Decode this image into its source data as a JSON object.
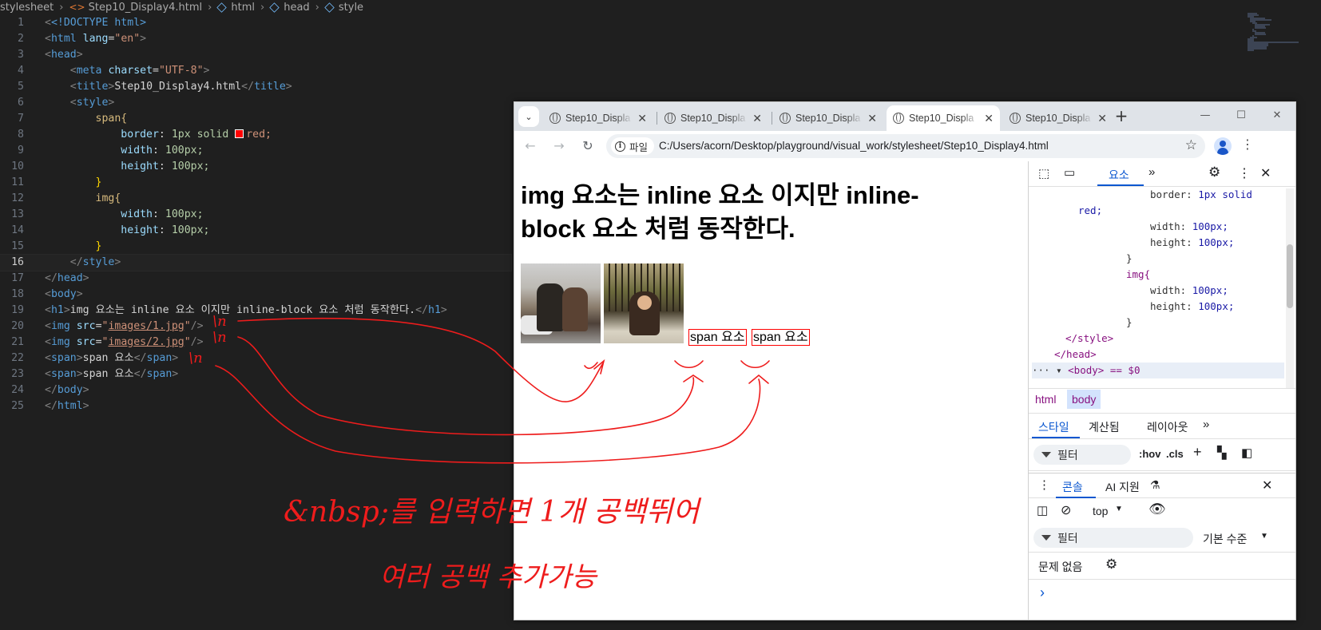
{
  "editor": {
    "breadcrumb": [
      "stylesheet",
      "Step10_Display4.html",
      "html",
      "head",
      "style"
    ],
    "active_line": 16,
    "lines": [
      {
        "n": "1"
      },
      {
        "n": "2"
      },
      {
        "n": "3"
      },
      {
        "n": "4"
      },
      {
        "n": "5"
      },
      {
        "n": "6"
      },
      {
        "n": "7"
      },
      {
        "n": "8"
      },
      {
        "n": "9"
      },
      {
        "n": "10"
      },
      {
        "n": "11"
      },
      {
        "n": "12"
      },
      {
        "n": "13"
      },
      {
        "n": "14"
      },
      {
        "n": "15"
      },
      {
        "n": "16"
      },
      {
        "n": "17"
      },
      {
        "n": "18"
      },
      {
        "n": "19"
      },
      {
        "n": "20"
      },
      {
        "n": "21"
      },
      {
        "n": "22"
      },
      {
        "n": "23"
      },
      {
        "n": "24"
      },
      {
        "n": "25"
      }
    ],
    "code": {
      "doctype": "<!DOCTYPE html>",
      "lang_attr": "lang",
      "lang_val": "\"en\"",
      "charset_val": "\"UTF-8\"",
      "title_text": "Step10_Display4.html",
      "span_sel": "span{",
      "border_prop": "border",
      "border_val_1": "1px solid",
      "border_val_2": "red;",
      "width_prop": "width",
      "width_val": "100px;",
      "height_prop": "height",
      "height_val": "100px;",
      "img_sel": "img{",
      "h1_text": "img 요소는 inline 요소 이지만 inline-block 요소 처럼 동작한다.",
      "img1_src": "images/1.jpg",
      "img2_src": "images/2.jpg",
      "span_text": "span 요소"
    }
  },
  "browser": {
    "tabs": [
      {
        "title": "Step10_Displa"
      },
      {
        "title": "Step10_Displa"
      },
      {
        "title": "Step10_Displa"
      },
      {
        "title": "Step10_Displa"
      },
      {
        "title": "Step10_Displa"
      }
    ],
    "active_tab": 3,
    "site_info_label": "파일",
    "url": "C:/Users/acorn/Desktop/playground/visual_work/stylesheet/Step10_Display4.html",
    "page": {
      "h1_line1": "img 요소는 inline 요소 이지만 inline-",
      "h1_line2": "block 요소 처럼 동작한다.",
      "span1": "span 요소",
      "span2": "span 요소"
    }
  },
  "devtools": {
    "main_tab": "요소",
    "dom_lines": {
      "l1_prop": "border:",
      "l1_val": "1px solid",
      "l2_val": "red;",
      "width": "width:",
      "height": "height:",
      "num": "100px;",
      "brace": "}",
      "img_sel": "img{",
      "style_close": "</style>",
      "head_close": "</head>",
      "body_line": "<body> == $0"
    },
    "breadcrumb": [
      "html",
      "body"
    ],
    "styles_tabs": [
      "스타일",
      "계산됨",
      "레이아웃"
    ],
    "filter_placeholder": "필터",
    "hov": ":hov",
    "cls": ".cls",
    "drawer_tabs": [
      "콘솔",
      "AI 지원"
    ],
    "context": "top",
    "console_filter": "필터",
    "log_level": "기본 수준",
    "issues": "문제 없음",
    "prompt": "›"
  },
  "annotations": {
    "newline_mark": "\\n",
    "note_line1": "&nbsp;를 입력하면  1개 공백뛰어",
    "note_line2": "여러 공백 추가가능"
  },
  "colors": {
    "editor_bg": "#1f1f1f",
    "ink_red": "#ee1c1c",
    "span_border": "#ff0000",
    "devtools_accent": "#0b57d0"
  }
}
